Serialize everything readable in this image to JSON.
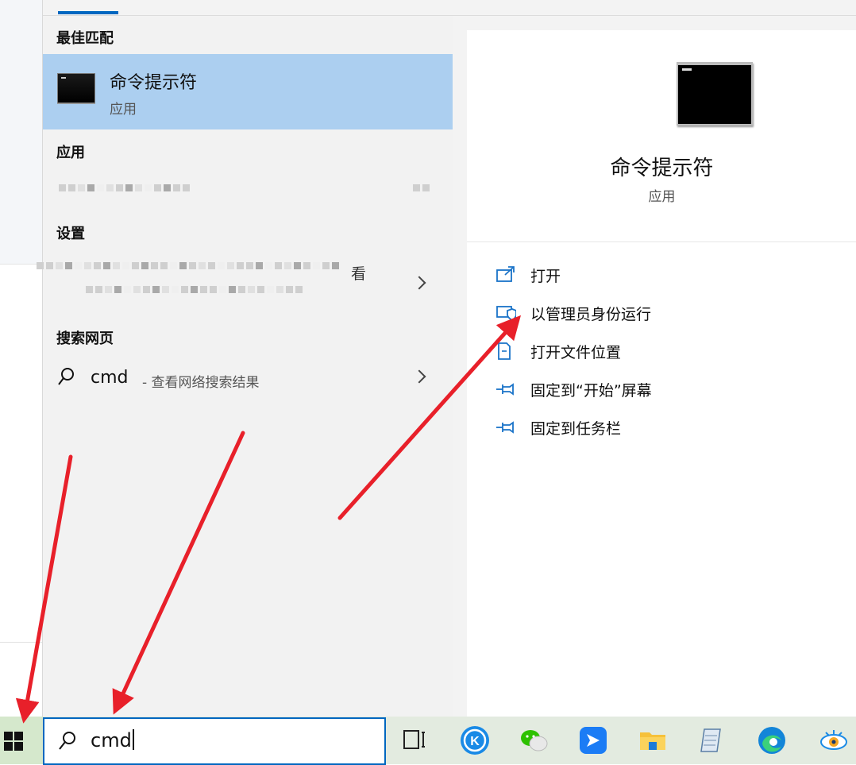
{
  "best_match": {
    "header": "最佳匹配",
    "title": "命令提示符",
    "subtitle": "应用"
  },
  "apps_section": {
    "header": "应用"
  },
  "settings_section": {
    "header": "设置",
    "item_partial_text": "看"
  },
  "web_section": {
    "header": "搜索网页",
    "query": "cmd",
    "description": "- 查看网络搜索结果"
  },
  "preview": {
    "title": "命令提示符",
    "subtitle": "应用",
    "actions": [
      {
        "label": "打开",
        "icon": "open-icon"
      },
      {
        "label": "以管理员身份运行",
        "icon": "shield-admin-icon"
      },
      {
        "label": "打开文件位置",
        "icon": "file-location-icon"
      },
      {
        "label": "固定到“开始”屏幕",
        "icon": "pin-icon"
      },
      {
        "label": "固定到任务栏",
        "icon": "pin-icon"
      }
    ]
  },
  "taskbar": {
    "search_value": "cmd",
    "icons": [
      "windows-start-icon",
      "task-view-icon",
      "kugou-icon",
      "wechat-icon",
      "feishu-icon",
      "file-explorer-icon",
      "notepad-icon",
      "edge-icon",
      "eye-app-icon"
    ]
  },
  "colors": {
    "selected_bg": "#accff0",
    "accent": "#0067c0",
    "arrow": "#e8202a"
  }
}
